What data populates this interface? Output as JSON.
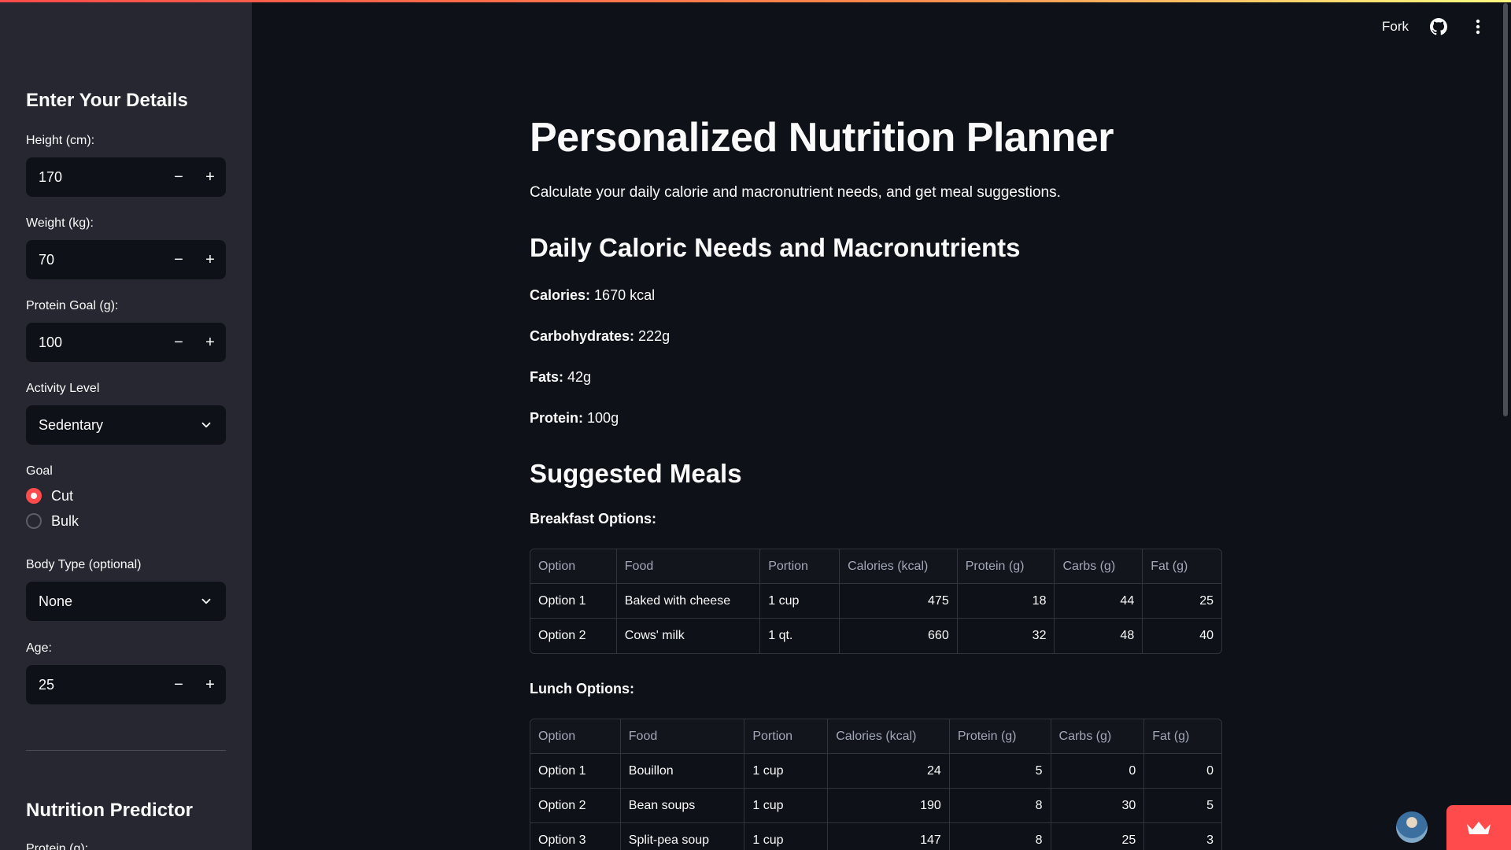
{
  "header": {
    "fork_label": "Fork",
    "github_icon": "github-icon",
    "menu_icon": "kebab-menu-icon"
  },
  "sidebar": {
    "title": "Enter Your Details",
    "height": {
      "label": "Height (cm):",
      "value": "170"
    },
    "weight": {
      "label": "Weight (kg):",
      "value": "70"
    },
    "protein_goal": {
      "label": "Protein Goal (g):",
      "value": "100"
    },
    "activity": {
      "label": "Activity Level",
      "value": "Sedentary"
    },
    "goal": {
      "label": "Goal",
      "options": [
        "Cut",
        "Bulk"
      ],
      "selected": "Cut"
    },
    "body_type": {
      "label": "Body Type (optional)",
      "value": "None"
    },
    "age": {
      "label": "Age:",
      "value": "25"
    },
    "predictor_title": "Nutrition Predictor",
    "predictor_first_label": "Protein (g):",
    "stepper_minus": "−",
    "stepper_plus": "+"
  },
  "main": {
    "title": "Personalized Nutrition Planner",
    "subtitle": "Calculate your daily calorie and macronutrient needs, and get meal suggestions.",
    "needs_heading": "Daily Caloric Needs and Macronutrients",
    "stats": [
      {
        "label": "Calories:",
        "value": "1670 kcal"
      },
      {
        "label": "Carbohydrates:",
        "value": "222g"
      },
      {
        "label": "Fats:",
        "value": "42g"
      },
      {
        "label": "Protein:",
        "value": "100g"
      }
    ],
    "meals_heading": "Suggested Meals",
    "breakfast": {
      "label": "Breakfast Options:",
      "columns": [
        "Option",
        "Food",
        "Portion",
        "Calories (kcal)",
        "Protein (g)",
        "Carbs (g)",
        "Fat (g)"
      ],
      "rows": [
        [
          "Option 1",
          "Baked with cheese",
          "1 cup",
          "475",
          "18",
          "44",
          "25"
        ],
        [
          "Option 2",
          "Cows' milk",
          "1 qt.",
          "660",
          "32",
          "48",
          "40"
        ]
      ]
    },
    "lunch": {
      "label": "Lunch Options:",
      "columns": [
        "Option",
        "Food",
        "Portion",
        "Calories (kcal)",
        "Protein (g)",
        "Carbs (g)",
        "Fat (g)"
      ],
      "rows": [
        [
          "Option 1",
          "Bouillon",
          "1 cup",
          "24",
          "5",
          "0",
          "0"
        ],
        [
          "Option 2",
          "Bean soups",
          "1 cup",
          "190",
          "8",
          "30",
          "5"
        ],
        [
          "Option 3",
          "Split-pea soup",
          "1 cup",
          "147",
          "8",
          "25",
          "3"
        ]
      ]
    }
  },
  "colors": {
    "accent": "#ff4b4b",
    "background": "#0e1117",
    "sidebar": "#262730"
  }
}
